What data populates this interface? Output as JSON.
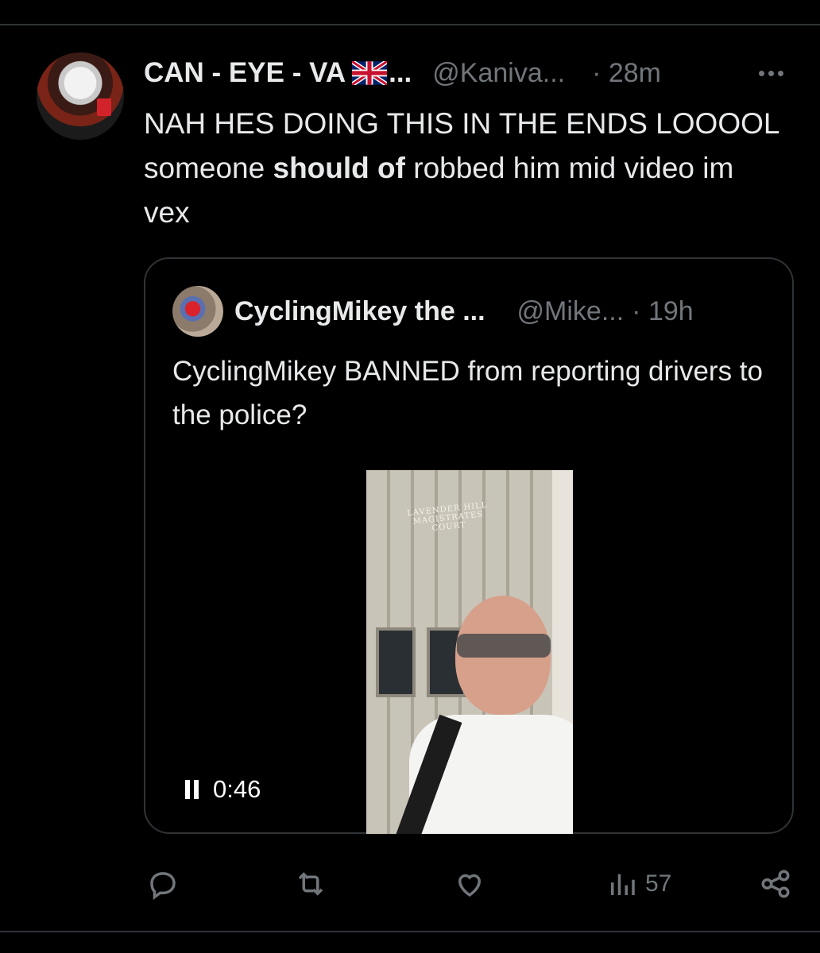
{
  "tweet": {
    "author_name": "CAN - EYE - VA",
    "flag_icon": "uk-flag-icon",
    "name_ellipsis": "...",
    "handle": "@Kaniva...",
    "time": "· 28m",
    "text_before": "NAH HES DOING THIS IN THE ENDS LOOOOL someone ",
    "text_bold": "should of",
    "text_after": " robbed him mid video im vex"
  },
  "quote": {
    "author_name": "CyclingMikey the ...",
    "handle": "@Mike...",
    "time": "· 19h",
    "text": "CyclingMikey BANNED from reporting drivers to the police?",
    "video": {
      "sign_text": "LAVENDER HILL MAGISTRATES COURT",
      "duration": "0:46",
      "state": "playing"
    }
  },
  "actions": {
    "reply_icon": "reply-icon",
    "retweet_icon": "retweet-icon",
    "like_icon": "like-icon",
    "views_icon": "views-icon",
    "views_count": "57",
    "share_icon": "share-icon"
  },
  "colors": {
    "background": "#000000",
    "text": "#e7e9ea",
    "secondary_text": "#71767b",
    "border": "#2f3336"
  }
}
